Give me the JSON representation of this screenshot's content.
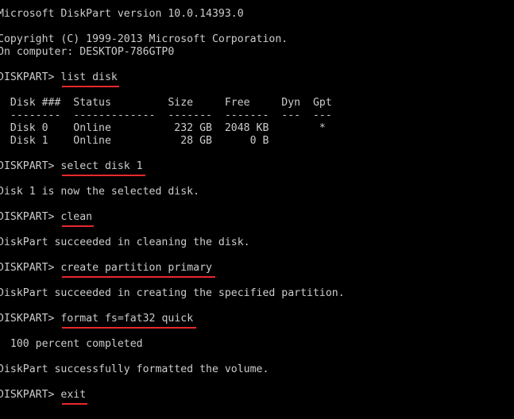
{
  "terminal": {
    "app_name": "DiskPart",
    "background_color": "#000000",
    "text_color": "#cccccc",
    "underline_color": "#e8282d",
    "prompt": "DISKPART> ",
    "header": {
      "version_line": "Microsoft DiskPart version 10.0.14393.0",
      "copyright_line": "Copyright (C) 1999-2013 Microsoft Corporation.",
      "computer_line": "On computer: DESKTOP-786GTP0"
    },
    "disk_table": {
      "header_row": "  Disk ###  Status         Size     Free     Dyn  Gpt",
      "separator_row": "  --------  -------------  -------  -------  ---  ---",
      "rows": [
        "  Disk 0    Online          232 GB  2048 KB        *",
        "  Disk 1    Online           28 GB      0 B"
      ],
      "columns": [
        "Disk ###",
        "Status",
        "Size",
        "Free",
        "Dyn",
        "Gpt"
      ],
      "data": [
        {
          "disk": "Disk 0",
          "status": "Online",
          "size": "232 GB",
          "free": "2048 KB",
          "dyn": "",
          "gpt": "*"
        },
        {
          "disk": "Disk 1",
          "status": "Online",
          "size": "28 GB",
          "free": "0 B",
          "dyn": "",
          "gpt": ""
        }
      ]
    },
    "commands": [
      {
        "text": "list disk",
        "underlined": true
      },
      {
        "text": "select disk 1",
        "underlined": true
      },
      {
        "text": "clean",
        "underlined": true
      },
      {
        "text": "create partition primary",
        "underlined": true
      },
      {
        "text": "format fs=fat32 quick",
        "underlined": true
      },
      {
        "text": "exit",
        "underlined": true
      }
    ],
    "responses": {
      "select_disk": "Disk 1 is now the selected disk.",
      "clean": "DiskPart succeeded in cleaning the disk.",
      "create_partition": "DiskPart succeeded in creating the specified partition.",
      "format_progress": "  100 percent completed",
      "format_done": "DiskPart successfully formatted the volume."
    }
  }
}
